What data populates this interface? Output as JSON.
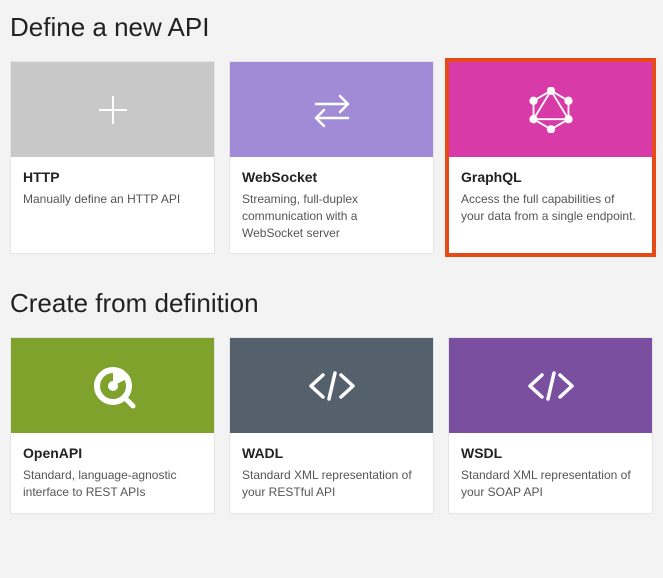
{
  "sections": {
    "define": {
      "heading": "Define a new API",
      "cards": {
        "http": {
          "title": "HTTP",
          "desc": "Manually define an HTTP API"
        },
        "websocket": {
          "title": "WebSocket",
          "desc": "Streaming, full-duplex communication with a WebSocket server"
        },
        "graphql": {
          "title": "GraphQL",
          "desc": "Access the full capabilities of your data from a single endpoint."
        }
      }
    },
    "create": {
      "heading": "Create from definition",
      "cards": {
        "openapi": {
          "title": "OpenAPI",
          "desc": "Standard, language-agnostic interface to REST APIs"
        },
        "wadl": {
          "title": "WADL",
          "desc": "Standard XML representation of your RESTful API"
        },
        "wsdl": {
          "title": "WSDL",
          "desc": "Standard XML representation of your SOAP API"
        }
      }
    }
  },
  "selected_card": "graphql",
  "colors": {
    "grey": "#c8c8c8",
    "lilac": "#a18bd6",
    "pink": "#d83ba8",
    "olive": "#7fa22d",
    "slate": "#54616d",
    "purple": "#7b4fa0",
    "selection_outline": "#e64a19"
  }
}
